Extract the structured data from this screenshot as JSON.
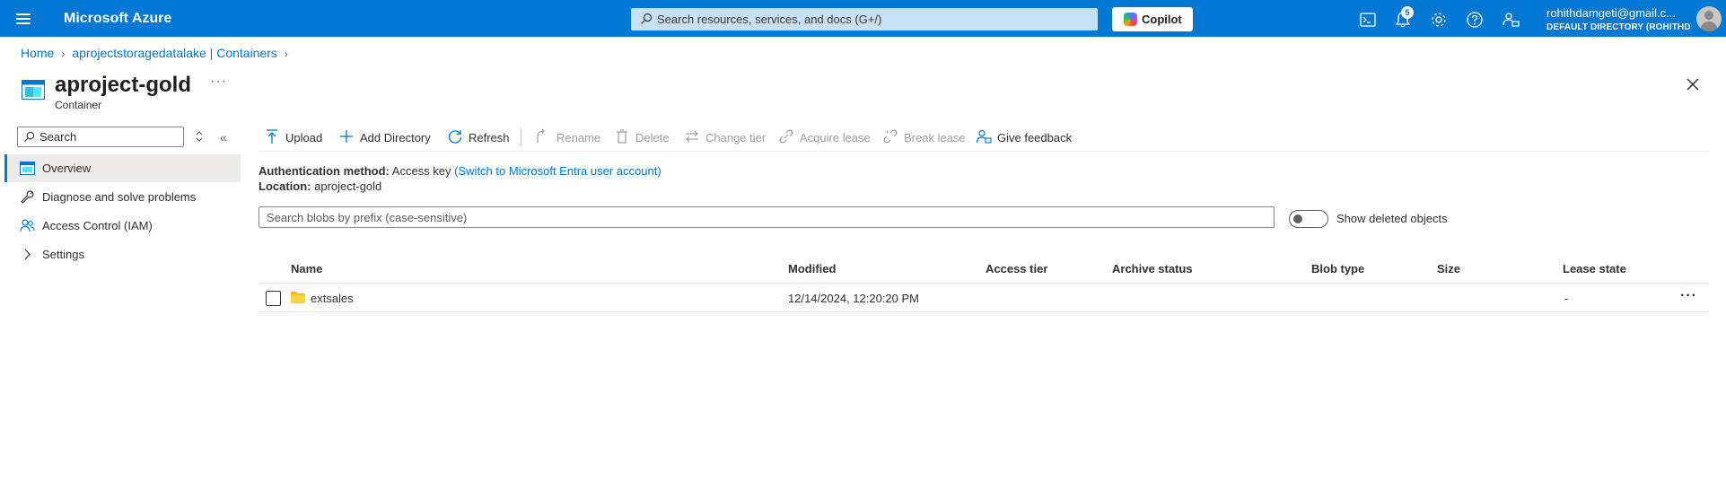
{
  "topbar": {
    "brand": "Microsoft Azure",
    "search_placeholder": "Search resources, services, and docs (G+/)",
    "copilot_label": "Copilot",
    "notification_count": "5",
    "icons": [
      "cloud-shell-icon",
      "bell-icon",
      "gear-icon",
      "help-icon",
      "feedback-icon"
    ],
    "user_email": "rohithdamgeti@gmail.c...",
    "user_directory": "DEFAULT DIRECTORY (ROHITHD..."
  },
  "breadcrumb": {
    "items": [
      "Home",
      "aprojectstoragedatalake | Containers"
    ]
  },
  "header": {
    "title": "aproject-gold",
    "subtitle": "Container",
    "more_label": "···"
  },
  "sidebar": {
    "search_placeholder": "Search",
    "collapse_label": "«",
    "items": [
      {
        "label": "Overview",
        "icon": "container-icon",
        "active": true
      },
      {
        "label": "Diagnose and solve problems",
        "icon": "wrench-icon"
      },
      {
        "label": "Access Control (IAM)",
        "icon": "people-icon"
      },
      {
        "label": "Settings",
        "icon": "chevron-right-icon"
      }
    ]
  },
  "toolbar": {
    "upload": "Upload",
    "add_directory": "Add Directory",
    "refresh": "Refresh",
    "rename": "Rename",
    "delete": "Delete",
    "change_tier": "Change tier",
    "acquire_lease": "Acquire lease",
    "break_lease": "Break lease",
    "give_feedback": "Give feedback"
  },
  "essentials": {
    "auth_label": "Authentication method:",
    "auth_value": "Access key",
    "auth_link": "(Switch to Microsoft Entra user account)",
    "location_label": "Location:",
    "location_value": "aproject-gold"
  },
  "filter": {
    "search_placeholder": "Search blobs by prefix (case-sensitive)",
    "show_deleted_label": "Show deleted objects",
    "show_deleted_on": false
  },
  "table": {
    "columns": [
      "Name",
      "Modified",
      "Access tier",
      "Archive status",
      "Blob type",
      "Size",
      "Lease state"
    ],
    "rows": [
      {
        "name": "extsales",
        "modified": "12/14/2024, 12:20:20 PM",
        "access_tier": "",
        "archive_status": "",
        "blob_type": "",
        "size": "",
        "lease_state": "-",
        "more": "···"
      }
    ]
  },
  "colors": {
    "accent": "#0078d4",
    "folder": "#ffb900",
    "disabled_text": "#a19f9d"
  }
}
